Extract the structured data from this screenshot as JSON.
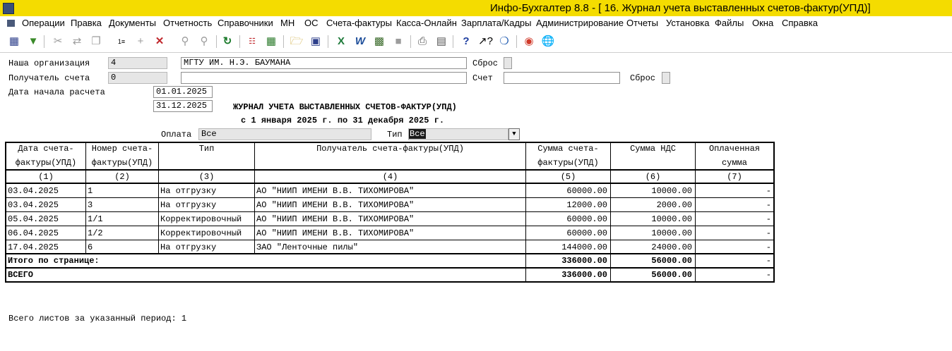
{
  "window": {
    "title": "Инфо-Бухгалтер 8.8 - [ 16. Журнал учета выставленных счетов-фактур(УПД)]"
  },
  "menu": [
    "Операции",
    "Правка",
    "Документы",
    "Отчетность",
    "Справочники",
    "МН",
    "ОС",
    "Счета-фактуры",
    "Касса-Онлайн",
    "Зарплата/Кадры",
    "Администрирование",
    "Отчеты",
    "Установка",
    "Файлы",
    "Окна",
    "Справка"
  ],
  "form": {
    "org_label": "Наша организация",
    "org_code": "4",
    "org_name": "МГТУ ИМ. Н.Э. БАУМАНА",
    "reset1_label": "Сброс",
    "recipient_label": "Получатель счета",
    "recipient_code": "0",
    "recipient_name": "",
    "account_label": "Счет",
    "account_value": "",
    "reset2_label": "Сброс",
    "date_label": "Дата начала расчета",
    "date_from": "01.01.2025",
    "date_to": "31.12.2025",
    "report_title": "ЖУРНАЛ УЧЕТА ВЫСТАВЛЕННЫХ СЧЕТОВ-ФАКТУР(УПД)",
    "report_period": "с 1 января 2025 г. по 31 декабря 2025 г.",
    "payment_label": "Оплата",
    "payment_value": "Все",
    "type_label": "Тип",
    "type_value": "Все"
  },
  "table": {
    "headers": [
      [
        "Дата счета-",
        "фактуры(УПД)"
      ],
      [
        "Номер счета-",
        "фактуры(УПД)"
      ],
      [
        "Тип",
        ""
      ],
      [
        "Получатель счета-фактуры(УПД)",
        ""
      ],
      [
        "Сумма счета-",
        "фактуры(УПД)"
      ],
      [
        "Сумма НДС",
        ""
      ],
      [
        "Оплаченная",
        "сумма"
      ]
    ],
    "col_numbers": [
      "(1)",
      "(2)",
      "(3)",
      "(4)",
      "(5)",
      "(6)",
      "(7)"
    ],
    "rows": [
      [
        "03.04.2025",
        "1",
        "На отгрузку",
        "АО \"НИИП ИМЕНИ В.В. ТИХОМИРОВА\"",
        "60000.00",
        "10000.00",
        "-"
      ],
      [
        "03.04.2025",
        "3",
        "На отгрузку",
        "АО \"НИИП ИМЕНИ В.В. ТИХОМИРОВА\"",
        "12000.00",
        "2000.00",
        "-"
      ],
      [
        "05.04.2025",
        "1/1",
        "Корректировочный",
        "АО \"НИИП ИМЕНИ В.В. ТИХОМИРОВА\"",
        "60000.00",
        "10000.00",
        "-"
      ],
      [
        "06.04.2025",
        "1/2",
        "Корректировочный",
        "АО \"НИИП ИМЕНИ В.В. ТИХОМИРОВА\"",
        "60000.00",
        "10000.00",
        "-"
      ],
      [
        "17.04.2025",
        "6",
        "На отгрузку",
        "ЗАО \"Ленточные пилы\"",
        "144000.00",
        "24000.00",
        "-"
      ]
    ],
    "page_total": {
      "label": "Итого по странице:",
      "sum": "336000.00",
      "vat": "56000.00",
      "paid": "-"
    },
    "grand_total": {
      "label": "ВСЕГО",
      "sum": "336000.00",
      "vat": "56000.00",
      "paid": "-"
    }
  },
  "footer": {
    "text": "Всего листов за указанный период: 1"
  }
}
